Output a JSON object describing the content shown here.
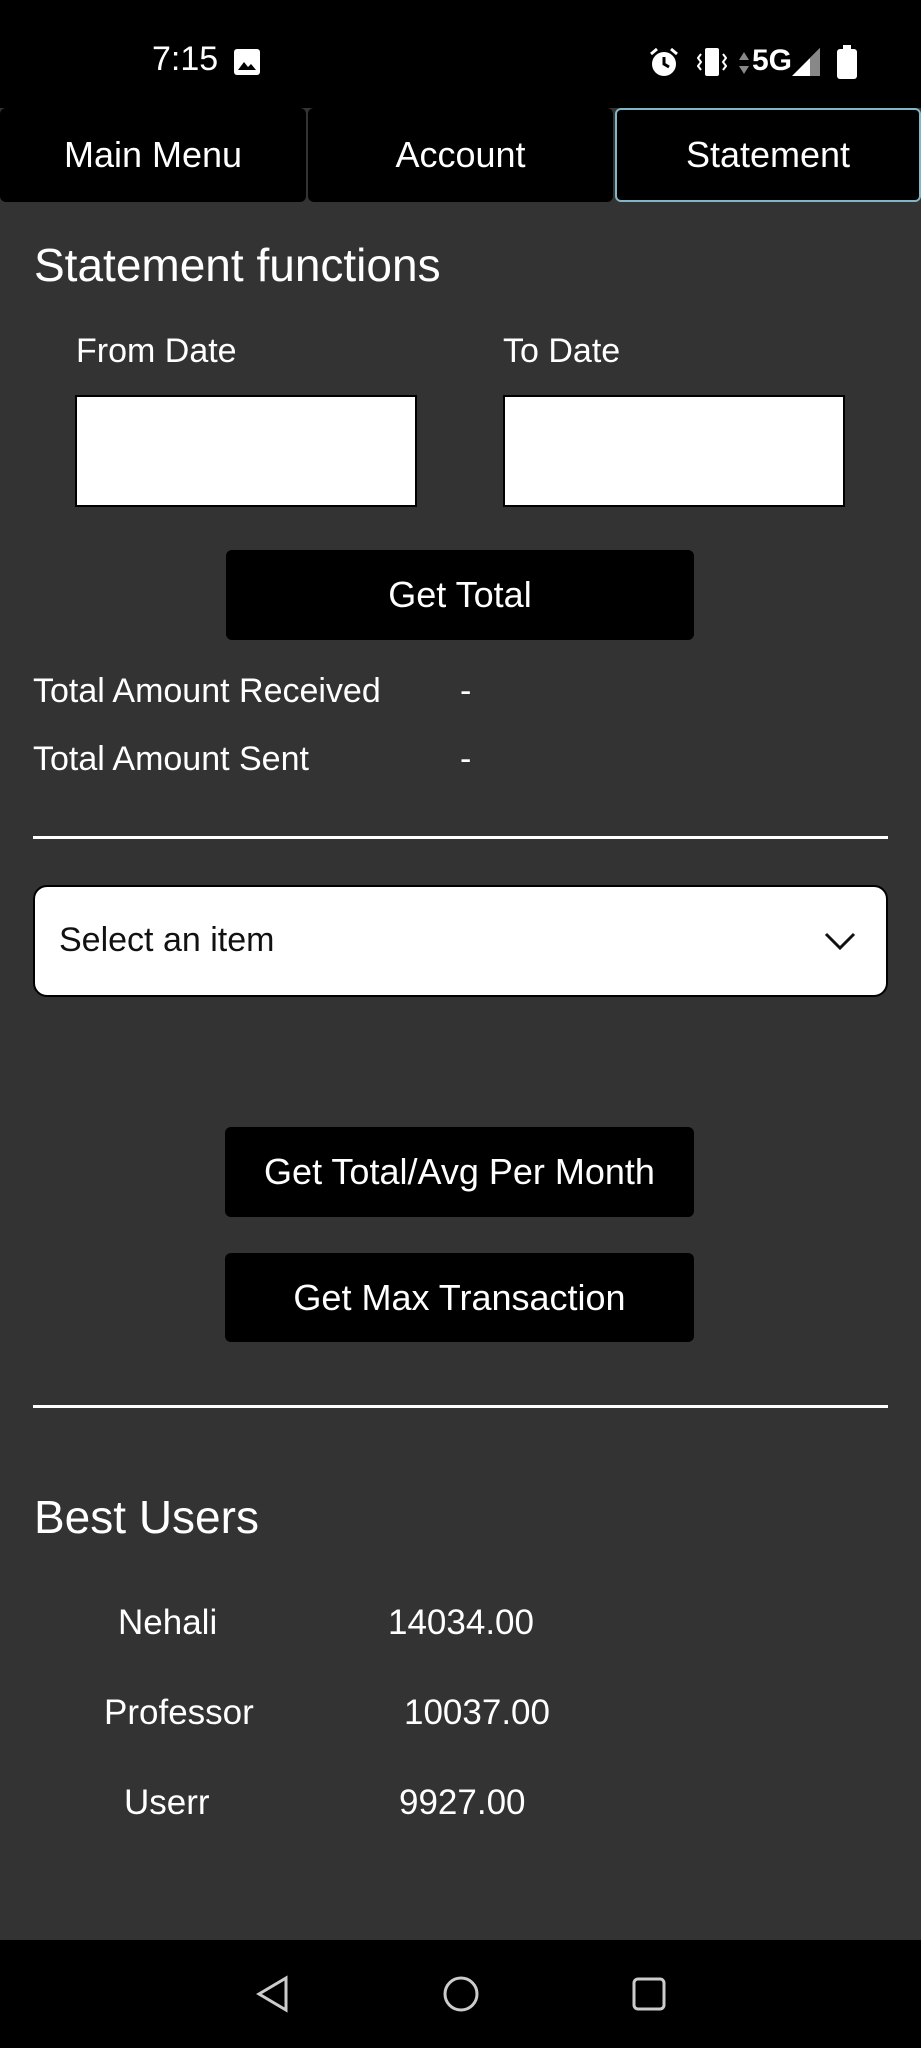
{
  "status_bar": {
    "time": "7:15",
    "network": "5G",
    "icons": [
      "image-icon",
      "alarm-icon",
      "vibrate-icon",
      "data-arrows-icon",
      "signal-icon",
      "battery-icon"
    ]
  },
  "tabs": [
    {
      "label": "Main Menu",
      "active": false
    },
    {
      "label": "Account",
      "active": false
    },
    {
      "label": "Statement",
      "active": true
    }
  ],
  "statement": {
    "title": "Statement functions",
    "from_label": "From Date",
    "to_label": "To Date",
    "from_value": "",
    "to_value": "",
    "get_total_label": "Get Total",
    "received_label": "Total Amount Received",
    "received_value": "-",
    "sent_label": "Total Amount Sent",
    "sent_value": "-"
  },
  "dropdown": {
    "selected": "Select an item"
  },
  "buttons": {
    "avg_per_month": "Get Total/Avg Per Month",
    "max_transaction": "Get Max Transaction"
  },
  "best_users": {
    "title": "Best Users",
    "users": [
      {
        "name": "Nehali",
        "amount": "14034.00"
      },
      {
        "name": "Professor",
        "amount": "10037.00"
      },
      {
        "name": "Userr",
        "amount": "9927.00"
      }
    ]
  },
  "nav": {
    "icons": [
      "back-icon",
      "home-icon",
      "recents-icon"
    ]
  },
  "colors": {
    "background": "#333333",
    "bar": "#000000",
    "active_tab_border": "#7fb7c8"
  }
}
